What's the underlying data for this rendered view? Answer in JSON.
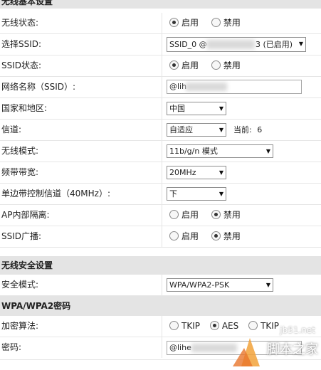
{
  "basic": {
    "title": "无线基本设置",
    "wireless_status": {
      "label": "无线状态:",
      "options": [
        "启用",
        "禁用"
      ]
    },
    "select_ssid": {
      "label": "选择SSID:",
      "value_prefix": "SSID_0 @",
      "value_suffix": "3 (已启用)"
    },
    "ssid_status": {
      "label": "SSID状态:",
      "options": [
        "启用",
        "禁用"
      ]
    },
    "network_name": {
      "label": "网络名称（SSID）:",
      "value": "@lih"
    },
    "country": {
      "label": "国家和地区:",
      "value": "中国"
    },
    "channel": {
      "label": "信道:",
      "value": "自适应",
      "current_label": "当前:",
      "current_value": "6"
    },
    "wireless_mode": {
      "label": "无线模式:",
      "value": "11b/g/n 模式"
    },
    "bandwidth": {
      "label": "频带带宽:",
      "value": "20MHz"
    },
    "sideband": {
      "label": "单边带控制信道（40MHz）:",
      "value": "下"
    },
    "ap_isolation": {
      "label": "AP内部隔离:",
      "options": [
        "启用",
        "禁用"
      ]
    },
    "ssid_broadcast": {
      "label": "SSID广播:",
      "options": [
        "启用",
        "禁用"
      ]
    }
  },
  "security": {
    "title": "无线安全设置",
    "mode": {
      "label": "安全模式:",
      "value": "WPA/WPA2-PSK"
    }
  },
  "wpa": {
    "title": "WPA/WPA2密码",
    "encryption": {
      "label": "加密算法:",
      "options": [
        "TKIP",
        "AES",
        "TKIP"
      ]
    },
    "password": {
      "label": "密码:",
      "value": "@lihe"
    }
  },
  "watermark": {
    "line1": "jb51.net",
    "line2": "脚本之家"
  }
}
